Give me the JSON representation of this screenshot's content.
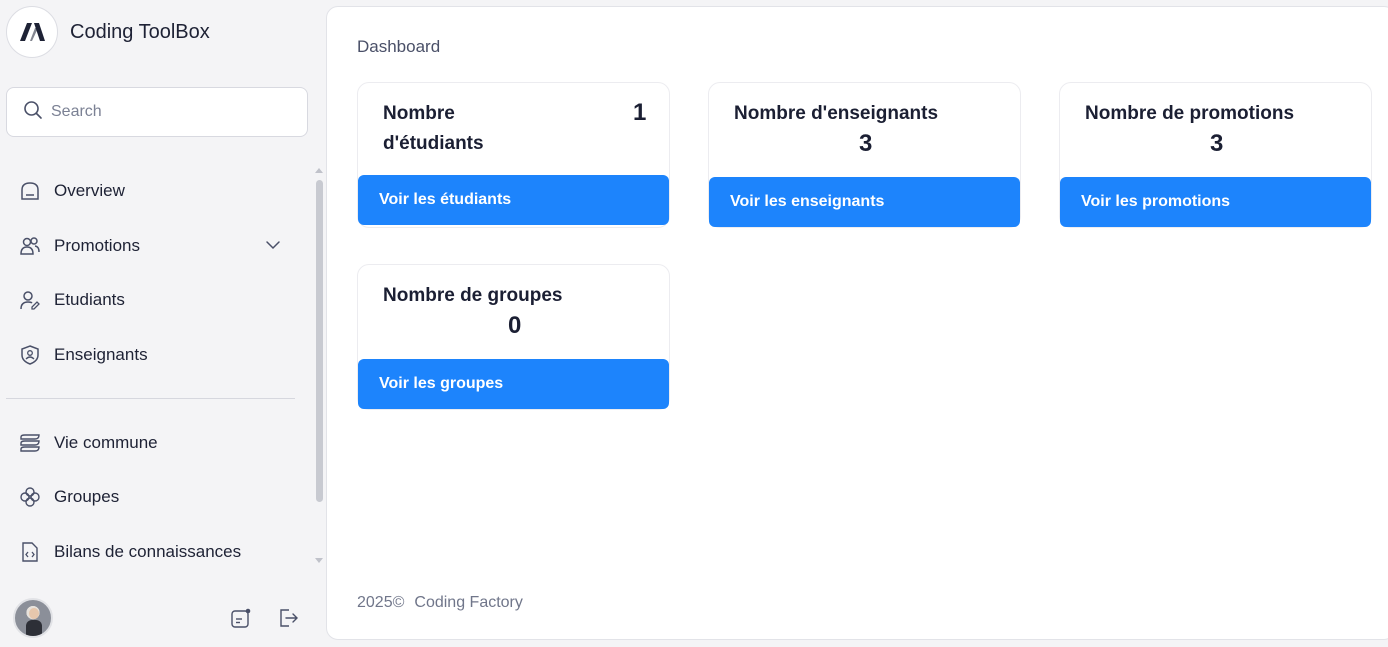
{
  "brand": {
    "title": "Coding ToolBox",
    "logo_icon": "coding-toolbox-logo-icon"
  },
  "search": {
    "placeholder": "Search"
  },
  "nav": {
    "items": [
      {
        "label": "Overview",
        "icon": "home-icon"
      },
      {
        "label": "Promotions",
        "icon": "users-icon",
        "has_submenu": true
      },
      {
        "label": "Etudiants",
        "icon": "user-edit-icon"
      },
      {
        "label": "Enseignants",
        "icon": "shield-user-icon"
      }
    ],
    "secondary": [
      {
        "label": "Vie commune",
        "icon": "stack-icon"
      },
      {
        "label": "Groupes",
        "icon": "flower-icon"
      },
      {
        "label": "Bilans de connaissances",
        "icon": "code-file-icon"
      }
    ]
  },
  "main": {
    "breadcrumb": "Dashboard",
    "cards": [
      {
        "title": "Nombre d'étudiants",
        "value": "1",
        "button": "Voir les étudiants"
      },
      {
        "title": "Nombre d'enseignants",
        "value": "3",
        "button": "Voir les enseignants"
      },
      {
        "title": "Nombre de promotions",
        "value": "3",
        "button": "Voir les promotions"
      },
      {
        "title": "Nombre de groupes",
        "value": "0",
        "button": "Voir les groupes"
      }
    ],
    "footer": {
      "year": "2025©",
      "company": "Coding Factory"
    }
  },
  "colors": {
    "accent": "#1d84fc",
    "sidebar_bg": "#f4f4f6",
    "text": "#1e2235"
  }
}
